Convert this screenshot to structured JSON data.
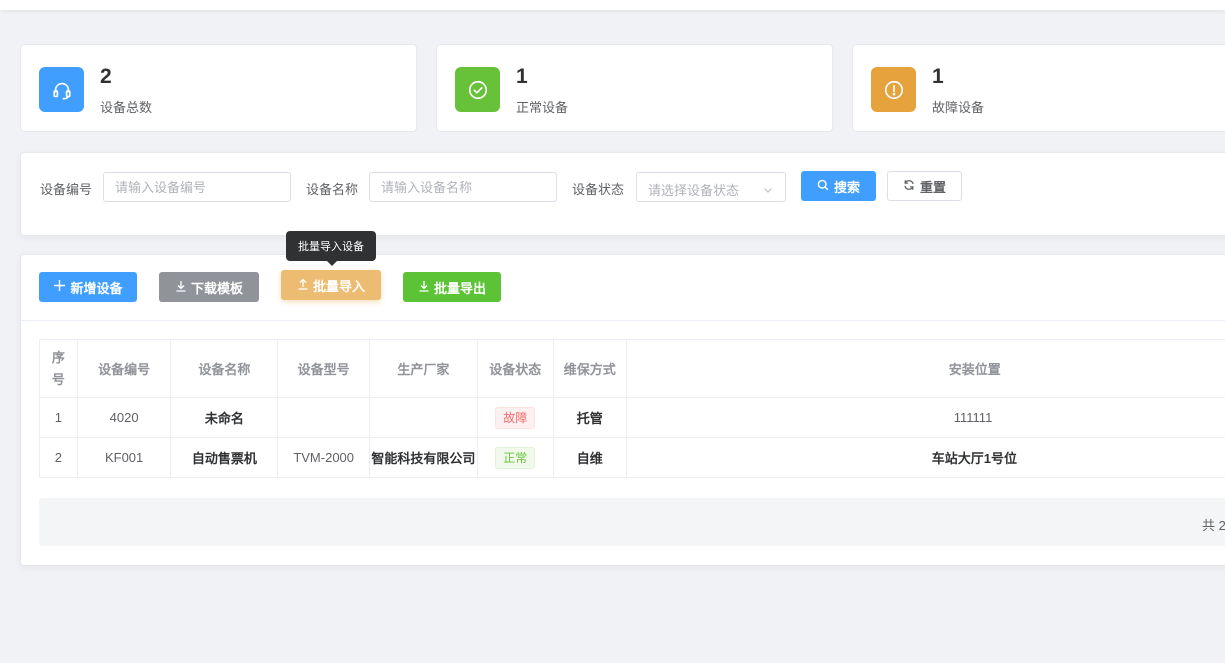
{
  "stats": [
    {
      "value": "2",
      "label": "设备总数",
      "icon": "headset-icon",
      "color": "#409eff"
    },
    {
      "value": "1",
      "label": "正常设备",
      "icon": "check-circle-icon",
      "color": "#67c23a"
    },
    {
      "value": "1",
      "label": "故障设备",
      "icon": "warning-circle-icon",
      "color": "#e6a23c"
    }
  ],
  "search": {
    "code_label": "设备编号",
    "code_placeholder": "请输入设备编号",
    "name_label": "设备名称",
    "name_placeholder": "请输入设备名称",
    "status_label": "设备状态",
    "status_placeholder": "请选择设备状态",
    "search_button": "搜索",
    "reset_button": "重置"
  },
  "toolbar": {
    "add": "新增设备",
    "download": "下载模板",
    "import": "批量导入",
    "export": "批量导出",
    "import_tooltip": "批量导入设备"
  },
  "table": {
    "headers": [
      "序号",
      "设备编号",
      "设备名称",
      "设备型号",
      "生产厂家",
      "设备状态",
      "维保方式",
      "安装位置"
    ],
    "rows": [
      {
        "index": "1",
        "code": "4020",
        "name": "未命名",
        "model": "",
        "maker": "",
        "status": "故障",
        "maintenance": "托管",
        "location": "111111"
      },
      {
        "index": "2",
        "code": "KF001",
        "name": "自动售票机",
        "model": "TVM-2000",
        "maker": "智能科技有限公司",
        "status": "正常",
        "maintenance": "自维",
        "location": "车站大厅1号位"
      }
    ]
  },
  "pagination": {
    "total_text": "共 2"
  }
}
